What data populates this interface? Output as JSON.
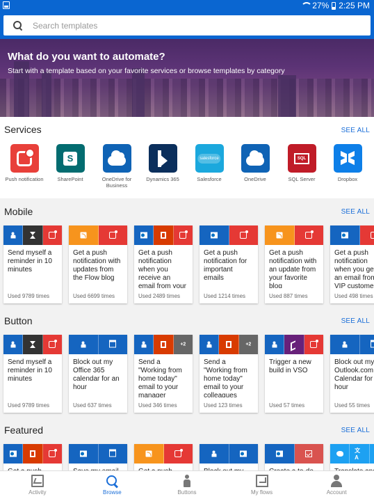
{
  "status_bar": {
    "battery": "27%",
    "time": "2:25 PM"
  },
  "search": {
    "placeholder": "Search templates"
  },
  "hero": {
    "title": "What do you want to automate?",
    "subtitle": "Start with a template based on your favorite services or browse templates by category"
  },
  "services": {
    "title": "Services",
    "see_all": "SEE ALL",
    "items": [
      {
        "label": "Push notification",
        "icon": "push-notification-icon",
        "color": "#e8403a"
      },
      {
        "label": "SharePoint",
        "icon": "sharepoint-icon",
        "color": "#036c70"
      },
      {
        "label": "OneDrive for Business",
        "icon": "onedrive-business-icon",
        "color": "#0f63b5"
      },
      {
        "label": "Dynamics 365",
        "icon": "dynamics-icon",
        "color": "#0b2f5c"
      },
      {
        "label": "Salesforce",
        "icon": "salesforce-icon",
        "color": "#1ba8dd"
      },
      {
        "label": "OneDrive",
        "icon": "onedrive-icon",
        "color": "#0f63b5"
      },
      {
        "label": "SQL Server",
        "icon": "sql-server-icon",
        "color": "#c01c28"
      },
      {
        "label": "Dropbox",
        "icon": "dropbox-icon",
        "color": "#0d7fe8"
      }
    ]
  },
  "mobile": {
    "title": "Mobile",
    "see_all": "SEE ALL",
    "cards": [
      {
        "segs": [
          [
            "#1565c0",
            "bell"
          ],
          [
            "#333333",
            "hour"
          ],
          [
            "#e53935",
            "push"
          ]
        ],
        "desc": "Send myself a reminder in 10 minutes",
        "used": "Used 9789 times"
      },
      {
        "segs": [
          [
            "#f7941d",
            "rss"
          ],
          [
            "#e53935",
            "push"
          ]
        ],
        "desc": "Get a push notification with updates from the Flow blog",
        "used": "Used 6699 times"
      },
      {
        "segs": [
          [
            "#1565c0",
            "outlook"
          ],
          [
            "#d83b01",
            "office"
          ],
          [
            "#e53935",
            "push"
          ]
        ],
        "desc": "Get a push notification when you receive an email from your boss",
        "used": "Used 2489 times"
      },
      {
        "segs": [
          [
            "#1565c0",
            "outlook"
          ],
          [
            "#e53935",
            "push"
          ]
        ],
        "desc": "Get a push notification for important emails",
        "used": "Used 1214 times"
      },
      {
        "segs": [
          [
            "#f7941d",
            "rss"
          ],
          [
            "#e53935",
            "push"
          ]
        ],
        "desc": "Get a push notification with an update from your favorite blog",
        "used": "Used 887 times"
      },
      {
        "segs": [
          [
            "#1565c0",
            "outlook"
          ],
          [
            "#e53935",
            "push"
          ]
        ],
        "desc": "Get a push notification when you get an email from a VIP customer",
        "used": "Used 498 times"
      }
    ]
  },
  "button": {
    "title": "Button",
    "see_all": "SEE ALL",
    "cards": [
      {
        "segs": [
          [
            "#1565c0",
            "bell"
          ],
          [
            "#333333",
            "hour"
          ],
          [
            "#e53935",
            "push"
          ]
        ],
        "desc": "Send myself a reminder in 10 minutes",
        "used": "Used 9789 times"
      },
      {
        "segs": [
          [
            "#1565c0",
            "bell"
          ],
          [
            "#1565c0",
            "cal"
          ]
        ],
        "desc": "Block out my Office 365 calendar for an hour",
        "used": "Used 637 times"
      },
      {
        "segs": [
          [
            "#1565c0",
            "bell"
          ],
          [
            "#d83b01",
            "office"
          ],
          [
            "#666666",
            "+2"
          ]
        ],
        "desc": "Send a \"Working from home today\" email to your manager",
        "used": "Used 346 times"
      },
      {
        "segs": [
          [
            "#1565c0",
            "bell"
          ],
          [
            "#d83b01",
            "office"
          ],
          [
            "#666666",
            "+2"
          ]
        ],
        "desc": "Send a \"Working from home today\" email to your colleagues",
        "used": "Used 123 times"
      },
      {
        "segs": [
          [
            "#1565c0",
            "bell"
          ],
          [
            "#68217a",
            "vs"
          ],
          [
            "#e53935",
            "push"
          ]
        ],
        "desc": "Trigger a new build in VSO",
        "used": "Used 57 times"
      },
      {
        "segs": [
          [
            "#1565c0",
            "bell"
          ],
          [
            "#1565c0",
            "cal"
          ]
        ],
        "desc": "Block out my Outlook.com Calendar for an hour",
        "used": "Used 55 times"
      }
    ]
  },
  "featured": {
    "title": "Featured",
    "see_all": "SEE ALL",
    "cards": [
      {
        "segs": [
          [
            "#1565c0",
            "outlook"
          ],
          [
            "#d83b01",
            "office"
          ],
          [
            "#e53935",
            "push"
          ]
        ],
        "desc": "Get a push"
      },
      {
        "segs": [
          [
            "#1565c0",
            "outlook"
          ],
          [
            "#1565c0",
            "cal"
          ]
        ],
        "desc": "Save my email"
      },
      {
        "segs": [
          [
            "#f7941d",
            "rss"
          ],
          [
            "#e53935",
            "push"
          ]
        ],
        "desc": "Get a push"
      },
      {
        "segs": [
          [
            "#1565c0",
            "bell"
          ],
          [
            "#1565c0",
            "outlook"
          ]
        ],
        "desc": "Block out my"
      },
      {
        "segs": [
          [
            "#1565c0",
            "outlook"
          ],
          [
            "#d9534f",
            "todo"
          ]
        ],
        "desc": "Create a to-do"
      },
      {
        "segs": [
          [
            "#1da1f2",
            "bird"
          ],
          [
            "#1da1f2",
            "trans"
          ],
          [
            "#1da1f2",
            "bird"
          ]
        ],
        "desc": "Translate and"
      }
    ]
  },
  "nav": {
    "items": [
      {
        "label": "Activity",
        "icon": "activity-icon"
      },
      {
        "label": "Browse",
        "icon": "browse-icon"
      },
      {
        "label": "Buttons",
        "icon": "buttons-icon"
      },
      {
        "label": "My flows",
        "icon": "my-flows-icon"
      },
      {
        "label": "Account",
        "icon": "account-icon"
      }
    ],
    "active": "Browse"
  }
}
